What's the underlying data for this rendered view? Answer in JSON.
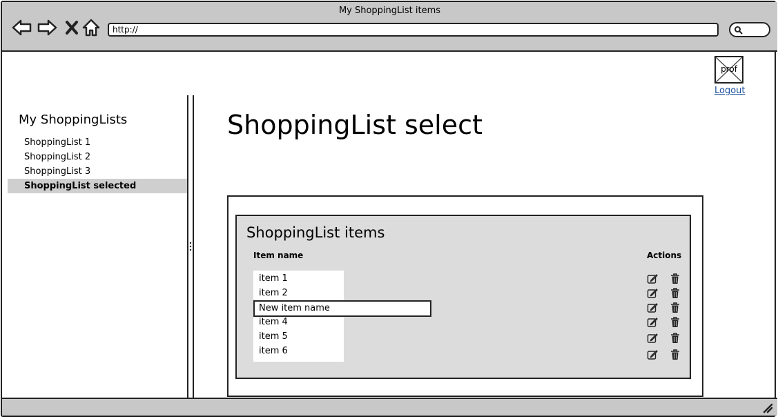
{
  "window": {
    "title": "My ShoppingList items"
  },
  "browser": {
    "url": "http://",
    "back_icon": "back-arrow-icon",
    "forward_icon": "forward-arrow-icon",
    "stop_icon": "close-icon",
    "home_icon": "home-icon",
    "search_icon": "search-icon"
  },
  "profile": {
    "image_label": "prof",
    "logout_label": "Logout"
  },
  "sidebar": {
    "title": "My ShoppingLists",
    "items": [
      {
        "label": "ShoppingList 1",
        "selected": false
      },
      {
        "label": "ShoppingList 2",
        "selected": false
      },
      {
        "label": "ShoppingList 3",
        "selected": false
      },
      {
        "label": "ShoppingList selected",
        "selected": true
      }
    ]
  },
  "main": {
    "title": "ShoppingList select",
    "panel": {
      "title": "ShoppingList items",
      "col_item_name": "Item name",
      "col_actions": "Actions",
      "items": [
        "item 1",
        "item 2",
        "New item name",
        "item 4",
        "item 5",
        "item 6"
      ],
      "editing_index": 2,
      "edit_icon": "edit-icon",
      "delete_icon": "trash-icon"
    }
  },
  "colors": {
    "chrome": "#c8c8c8",
    "selected": "#cfcfcf",
    "panel": "#dcdcdc",
    "link": "#1a4f9c"
  }
}
